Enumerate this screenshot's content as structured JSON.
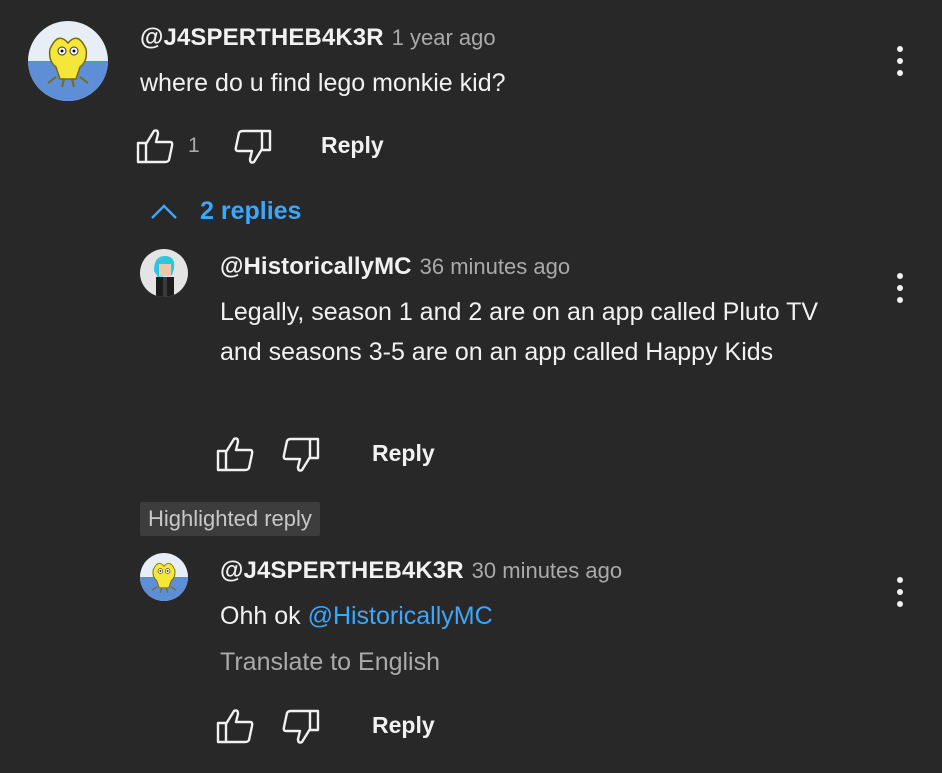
{
  "comment": {
    "author": "@J4SPERTHEB4K3R",
    "time": "1 year ago",
    "text": "where do u find lego monkie kid?",
    "like_count": "1",
    "reply_label": "Reply"
  },
  "replies_toggle": {
    "label": "2 replies"
  },
  "reply1": {
    "author": "@HistoricallyMC",
    "time": "36 minutes ago",
    "text": "Legally, season 1 and 2 are on an app called Pluto TV and seasons 3-5 are on an app called Happy Kids",
    "reply_label": "Reply"
  },
  "highlighted_badge": {
    "label": "Highlighted reply"
  },
  "reply2": {
    "author": "@J4SPERTHEB4K3R",
    "time": "30 minutes ago",
    "text_prefix": "Ohh ok ",
    "mention": "@HistoricallyMC",
    "translate_label": "Translate to English",
    "reply_label": "Reply"
  },
  "icons": {
    "like": "thumbs-up-icon",
    "dislike": "thumbs-down-icon",
    "menu": "more-vert-icon",
    "collapse": "chevron-up-icon"
  },
  "colors": {
    "background": "#282828",
    "link": "#3ea6ff",
    "secondary": "#aaaaaa"
  }
}
